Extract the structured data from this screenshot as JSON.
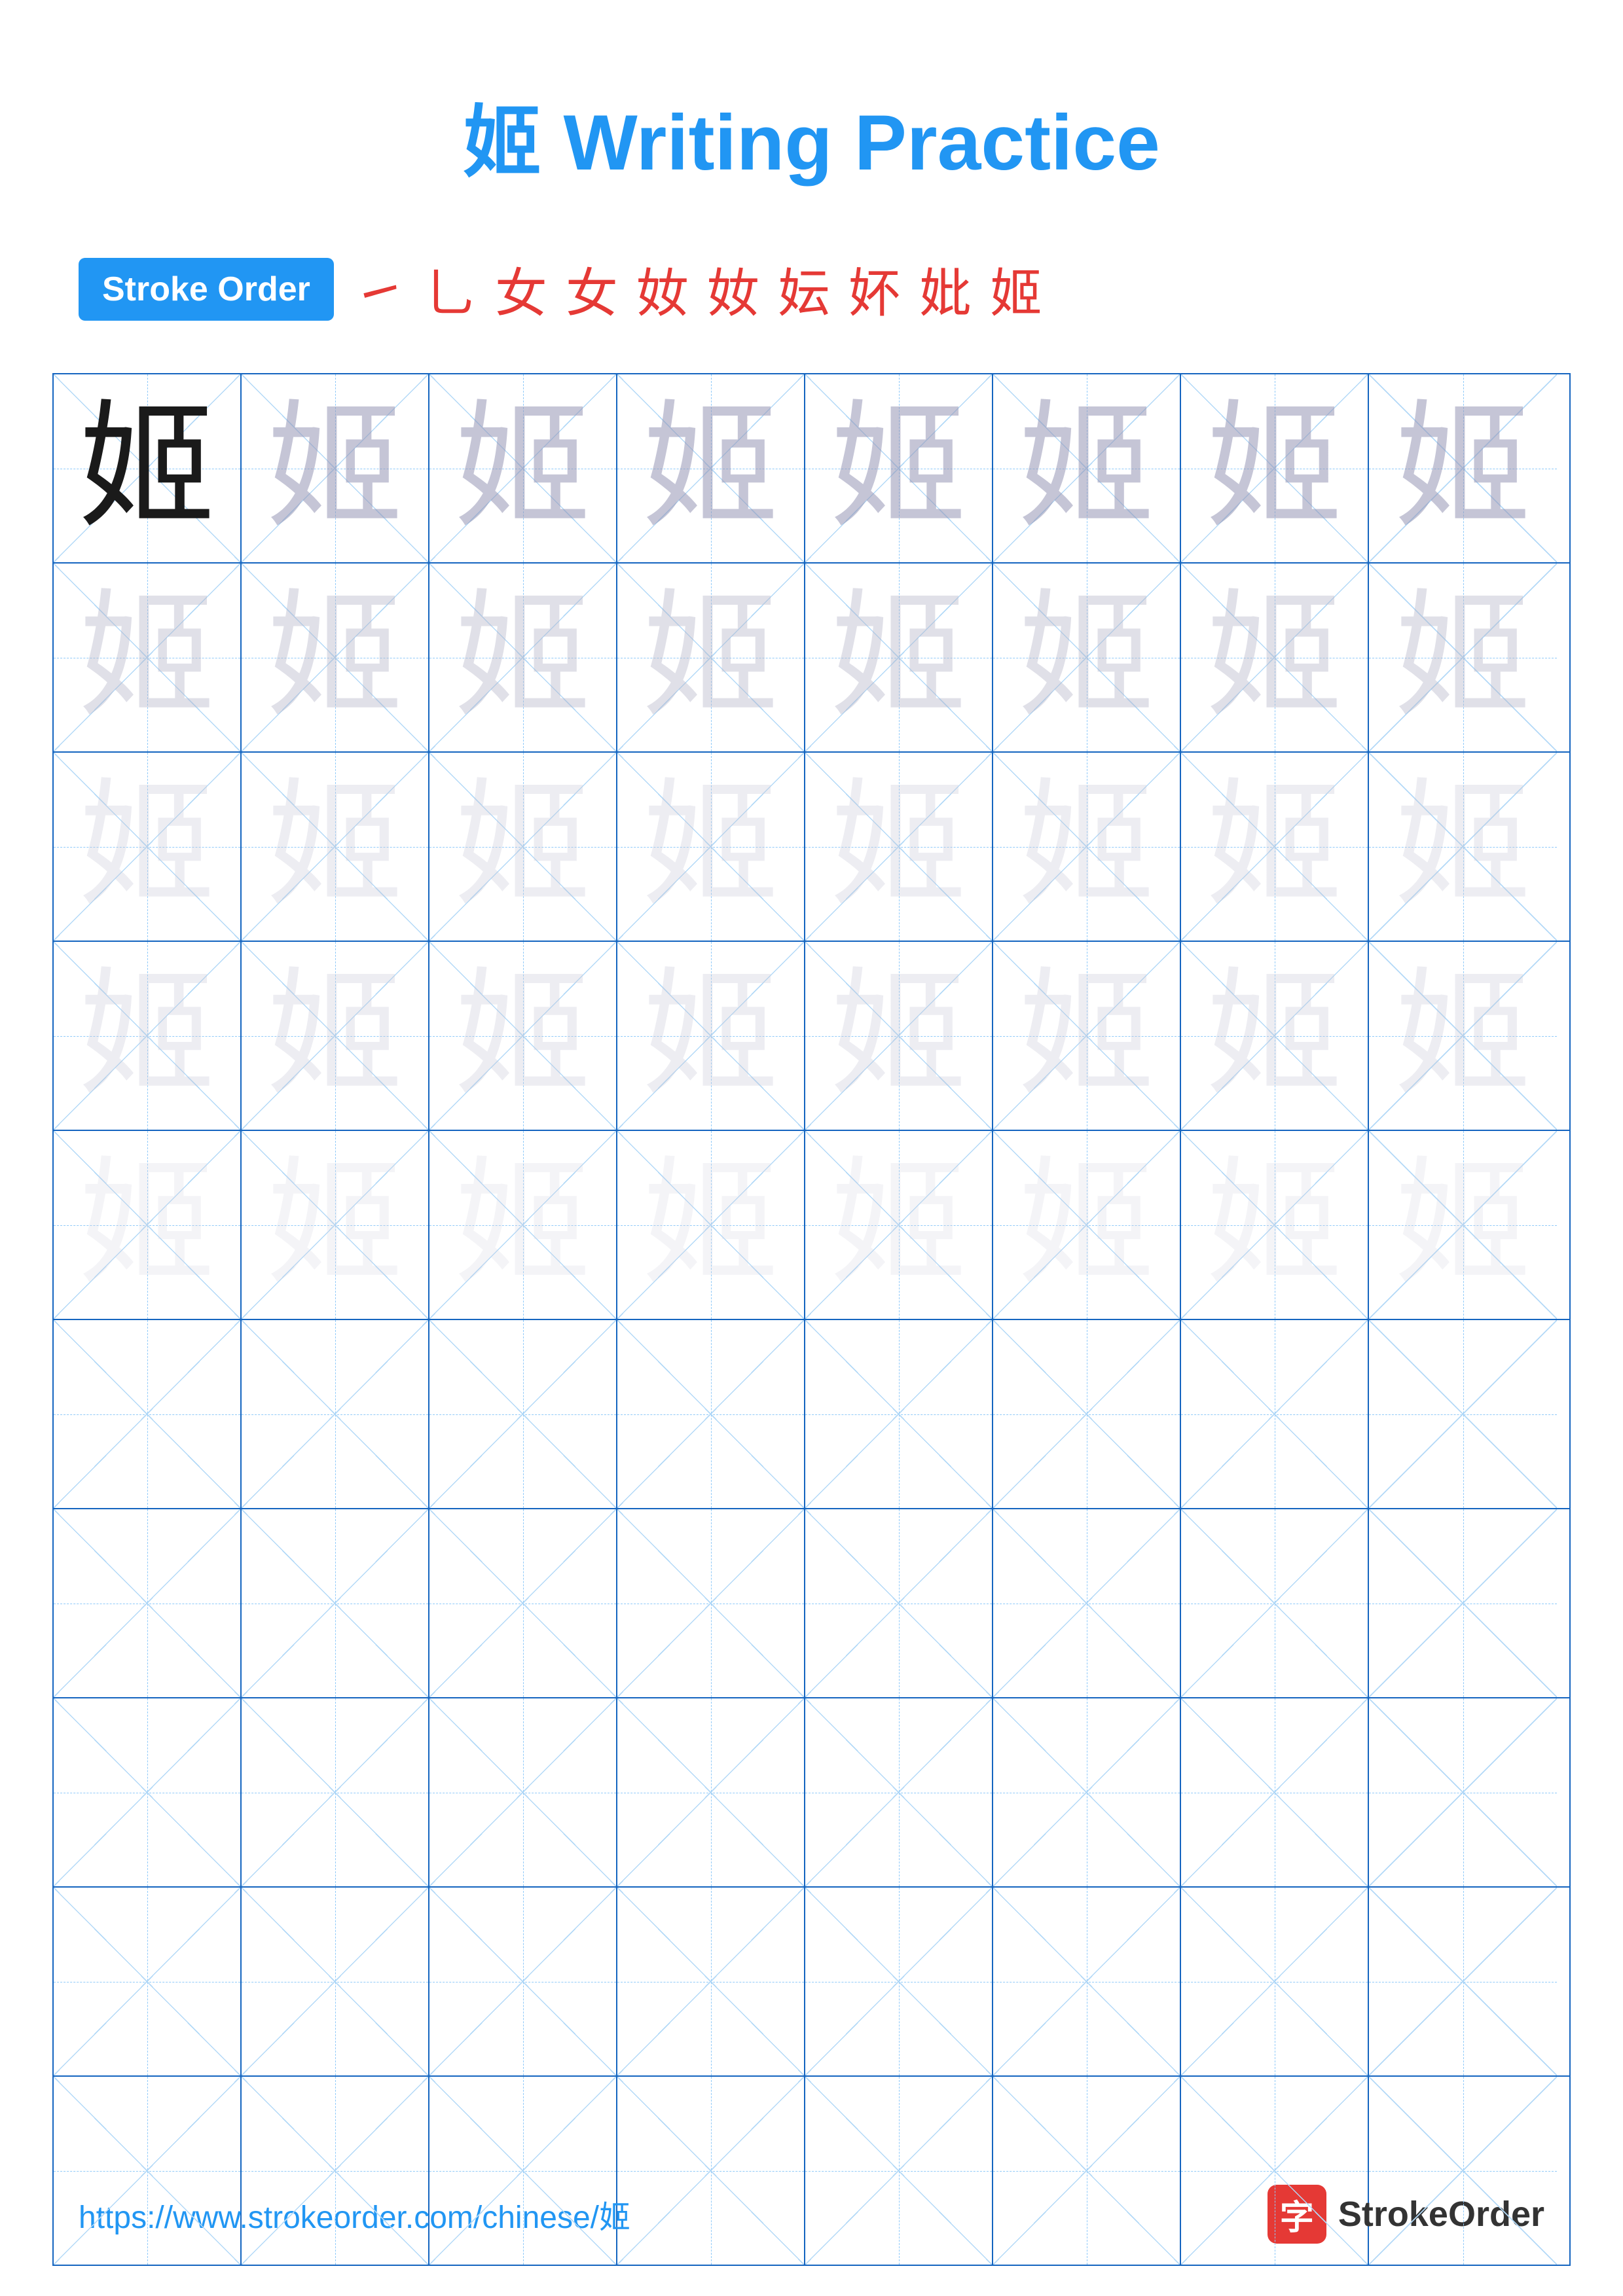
{
  "title": "姬 Writing Practice",
  "stroke_order": {
    "badge_label": "Stroke Order",
    "steps": [
      "㇐",
      "乚",
      "女",
      "女",
      "奻",
      "奻",
      "妘",
      "妚",
      "妣",
      "姬"
    ]
  },
  "character": "姬",
  "grid": {
    "rows": 10,
    "cols": 8
  },
  "footer": {
    "url": "https://www.strokeorder.com/chinese/姬",
    "brand_icon": "字",
    "brand_name": "StrokeOrder"
  }
}
